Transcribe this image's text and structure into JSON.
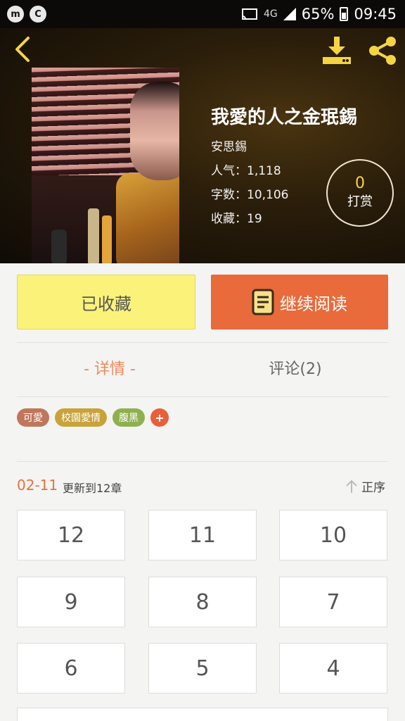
{
  "status_bar": {
    "icons": [
      "m-notification-icon",
      "c-notification-icon"
    ],
    "network": "4G",
    "battery": "65%",
    "time": "09:45"
  },
  "header": {
    "back_icon": "chevron-left-icon",
    "download_icon": "download-icon",
    "share_icon": "share-icon"
  },
  "book": {
    "title": "我愛的人之金珉錫",
    "author": "安思錫",
    "popularity": "人气：1,118",
    "word_count": "字数：10,106",
    "favorites": "收藏：19"
  },
  "tip": {
    "count": "0",
    "label": "打赏"
  },
  "actions": {
    "favorite_label": "已收藏",
    "continue_label": "继续阅读",
    "continue_icon": "book-icon"
  },
  "tabs": [
    {
      "label": "- 详情 -",
      "active": true
    },
    {
      "label": "评论(2)",
      "active": false
    }
  ],
  "tags": [
    {
      "label": "可愛",
      "color": "#c0765a"
    },
    {
      "label": "校園愛情",
      "color": "#c9a23a"
    },
    {
      "label": "腹黑",
      "color": "#8fb04e"
    }
  ],
  "tag_add": "+",
  "update": {
    "date": "02-11",
    "text": "更新到12章",
    "sort_label": "正序",
    "sort_icon": "arrow-up-icon"
  },
  "chapters": [
    "12",
    "11",
    "10",
    "9",
    "8",
    "7",
    "6",
    "5",
    "4"
  ],
  "colors": {
    "accent": "#e96a3a",
    "favorite_bg": "#fbf27a",
    "tab_active": "#ec8a5c"
  }
}
